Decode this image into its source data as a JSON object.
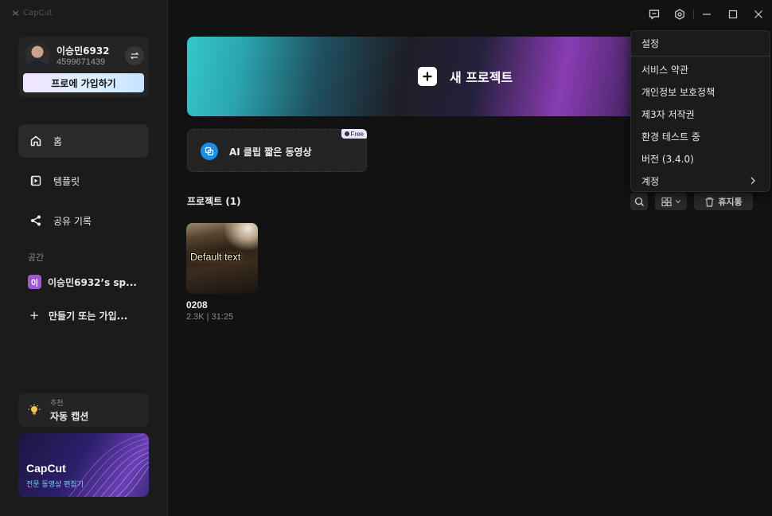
{
  "app": {
    "logo_text": "CapCut"
  },
  "profile": {
    "name": "이승민6932",
    "id": "4599671439",
    "pro_button": "프로에 가입하기"
  },
  "nav": {
    "home": "홈",
    "templates": "템플릿",
    "share_history": "공유 기록"
  },
  "spaces": {
    "section_label": "공간",
    "badge": "이",
    "space_name": "이승민6932’s sp...",
    "create_label": "만들기 또는 가입..."
  },
  "recommend": {
    "small_label": "추천",
    "title": "자동 캡션"
  },
  "promo": {
    "title": "CapCut",
    "subtitle": "전문 동영상 편집기"
  },
  "main": {
    "new_project": "새 프로젝트",
    "ai_clip": "AI 클립 짧은 동영상",
    "free_badge": "Free",
    "projects_title": "프로젝트 (1)",
    "trash_label": "휴지통"
  },
  "projects": [
    {
      "thumb_text": "Default text",
      "name": "0208",
      "meta": "2.3K | 31:25"
    }
  ],
  "settings_menu": {
    "header": "설정",
    "items": [
      "서비스 약관",
      "개인정보 보호정책",
      "제3자 저작권",
      "환경 테스트 중",
      "버전 (3.4.0)",
      "계정"
    ]
  },
  "colors": {
    "background": "#121212",
    "sidebar": "#1b1b1b",
    "accent_blue": "#1a8fe8",
    "space_badge": "#9b59d6"
  }
}
